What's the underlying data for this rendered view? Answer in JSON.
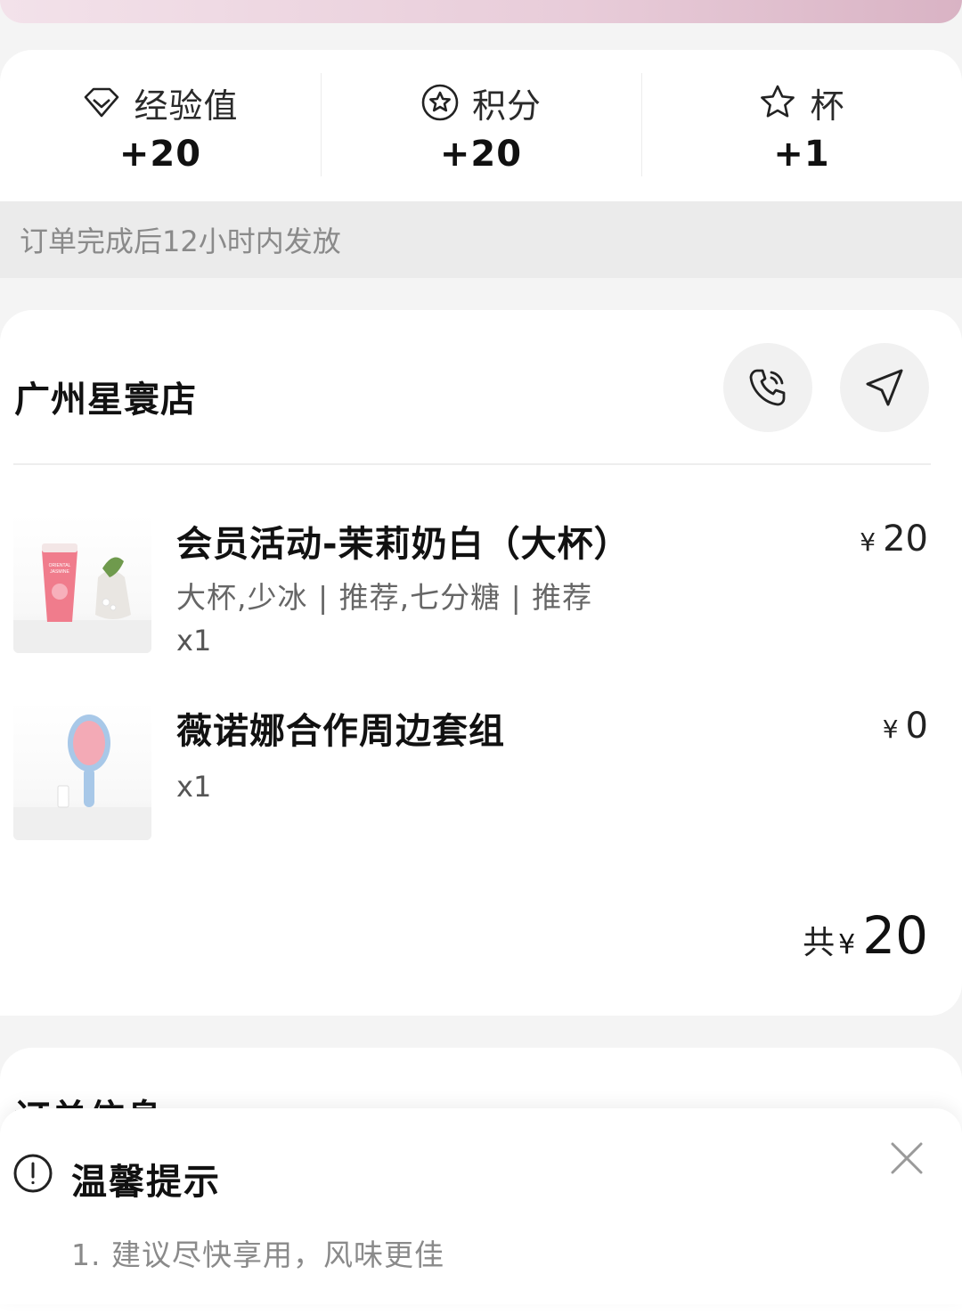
{
  "rewards": {
    "items": [
      {
        "icon": "diamond-icon",
        "label": "经验值",
        "value": "+20"
      },
      {
        "icon": "points-star-icon",
        "label": "积分",
        "value": "+20"
      },
      {
        "icon": "star-icon",
        "label": "杯",
        "value": "+1"
      }
    ],
    "note": "订单完成后12小时内发放"
  },
  "store": {
    "name": "广州星寰店",
    "call_icon": "phone-icon",
    "navigate_icon": "navigation-icon"
  },
  "products": [
    {
      "name": "会员活动-茉莉奶白（大杯）",
      "spec": "大杯,少冰 | 推荐,七分糖 | 推荐",
      "qty": "x1",
      "currency": "¥",
      "price": "20",
      "image": "jasmine-milk-tea-cup-image"
    },
    {
      "name": "薇诺娜合作周边套组",
      "spec": "",
      "qty": "x1",
      "currency": "¥",
      "price": "0",
      "image": "hair-brush-set-image"
    }
  ],
  "total": {
    "label": "共",
    "currency": "¥",
    "value": "20"
  },
  "order_info": {
    "title": "订单信息"
  },
  "tip": {
    "icon": "exclamation-circle-icon",
    "title": "温馨提示",
    "line1": "1. 建议尽快享用，风味更佳",
    "close_icon": "close-icon"
  },
  "colors": {
    "page_bg": "#f4f4f4",
    "card_bg": "#ffffff",
    "note_bg": "#ebebeb",
    "muted_text": "#8a8a8a",
    "banner_pink": "#e8ccd9"
  }
}
